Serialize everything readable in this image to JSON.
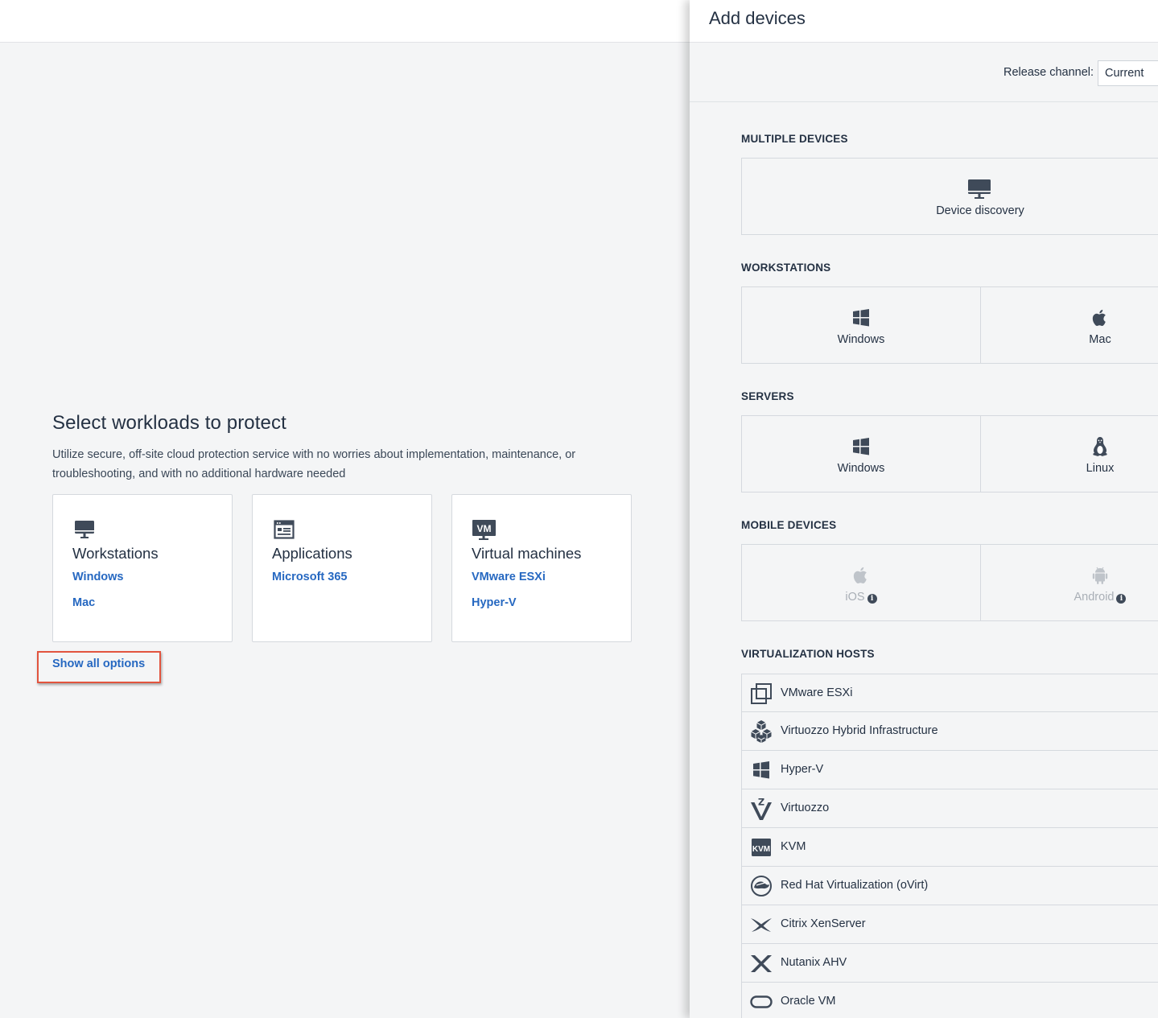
{
  "main": {
    "title": "Select workloads to protect",
    "description": "Utilize secure, off-site cloud protection service with no worries about implementation, maintenance, or troubleshooting, and with no additional hardware needed",
    "cards": [
      {
        "title": "Workstations",
        "icon": "monitor-icon",
        "links": [
          "Windows",
          "Mac"
        ]
      },
      {
        "title": "Applications",
        "icon": "application-window-icon",
        "links": [
          "Microsoft 365"
        ]
      },
      {
        "title": "Virtual machines",
        "icon": "vm-icon",
        "icon_text": "VM",
        "links": [
          "VMware ESXi",
          "Hyper-V"
        ]
      }
    ],
    "show_all_label": "Show all options",
    "highlight_color": "#e2543e",
    "link_color": "#2668c1"
  },
  "panel": {
    "title": "Add devices",
    "release_channel_label": "Release channel:",
    "release_channel_value": "Current",
    "sections": {
      "multiple": {
        "title": "MULTIPLE DEVICES",
        "items": [
          {
            "label": "Device discovery",
            "icon": "monitor-icon"
          }
        ]
      },
      "workstations": {
        "title": "WORKSTATIONS",
        "items": [
          {
            "label": "Windows",
            "icon": "windows-icon"
          },
          {
            "label": "Mac",
            "icon": "apple-icon"
          }
        ]
      },
      "servers": {
        "title": "SERVERS",
        "items": [
          {
            "label": "Windows",
            "icon": "windows-icon"
          },
          {
            "label": "Linux",
            "icon": "linux-penguin-icon"
          }
        ]
      },
      "mobile": {
        "title": "MOBILE DEVICES",
        "items": [
          {
            "label": "iOS",
            "icon": "apple-icon",
            "disabled": true
          },
          {
            "label": "Android",
            "icon": "android-icon",
            "disabled": true
          }
        ]
      },
      "virtualization": {
        "title": "VIRTUALIZATION HOSTS",
        "items": [
          {
            "label": "VMware ESXi",
            "icon": "vmware-icon"
          },
          {
            "label": "Virtuozzo Hybrid Infrastructure",
            "icon": "cubes-icon"
          },
          {
            "label": "Hyper-V",
            "icon": "windows-icon"
          },
          {
            "label": "Virtuozzo",
            "icon": "virtuozzo-icon"
          },
          {
            "label": "KVM",
            "icon": "kvm-icon",
            "icon_text": "KVM"
          },
          {
            "label": "Red Hat Virtualization (oVirt)",
            "icon": "redhat-icon"
          },
          {
            "label": "Citrix XenServer",
            "icon": "citrix-icon"
          },
          {
            "label": "Nutanix AHV",
            "icon": "nutanix-icon"
          },
          {
            "label": "Oracle VM",
            "icon": "oracle-icon"
          }
        ]
      }
    }
  }
}
